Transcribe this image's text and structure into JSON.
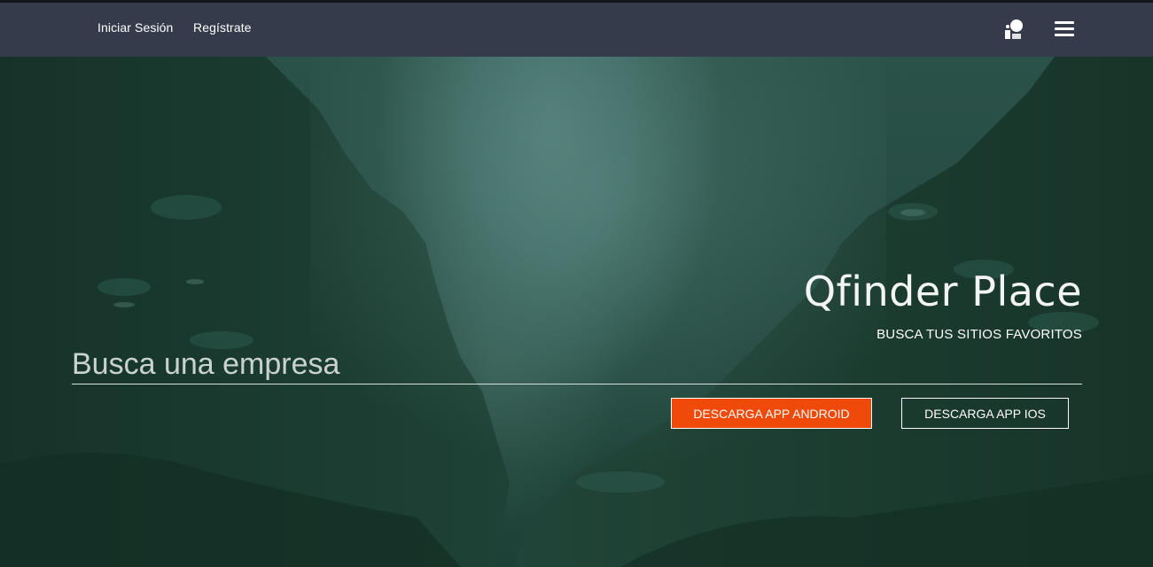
{
  "nav": {
    "login_label": "Iniciar Sesión",
    "register_label": "Regístrate",
    "user_icon": "user-location-icon",
    "menu_icon": "hamburger-menu-icon"
  },
  "hero": {
    "title": "Qfinder Place",
    "subtitle": "BUSCA TUS SITIOS FAVORITOS",
    "search": {
      "placeholder": "Busca una empresa",
      "value": ""
    },
    "buttons": {
      "android_label": "DESCARGA APP ANDROID",
      "ios_label": "DESCARGA APP IOS"
    }
  },
  "colors": {
    "navbar": "#363b4b",
    "accent": "#ef4a0a",
    "hero_bg": "#244a41"
  }
}
